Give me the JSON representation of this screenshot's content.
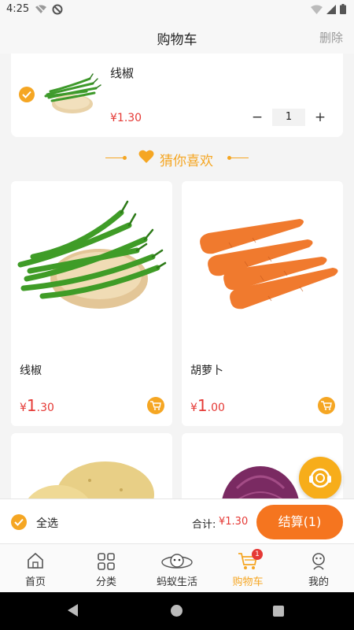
{
  "status_bar": {
    "time": "4:25",
    "icons": [
      "wifi-off-icon",
      "sync-disabled-icon",
      "wifi-icon",
      "signal-icon",
      "battery-icon"
    ]
  },
  "header": {
    "title": "购物车",
    "delete_label": "删除"
  },
  "cart_items": [
    {
      "name": "线椒",
      "price": "¥1.30",
      "quantity": "1",
      "minus": "−",
      "plus": "+",
      "checked": true
    }
  ],
  "recommend": {
    "title": "猜你喜欢",
    "products": [
      {
        "name": "线椒",
        "currency": "¥",
        "price_int": "1",
        "price_dec": ".30"
      },
      {
        "name": "胡萝卜",
        "currency": "¥",
        "price_int": "1",
        "price_dec": ".00"
      },
      {
        "name": "",
        "currency": "",
        "price_int": "",
        "price_dec": ""
      },
      {
        "name": "",
        "currency": "",
        "price_int": "",
        "price_dec": ""
      }
    ]
  },
  "checkout": {
    "select_all_label": "全选",
    "total_label": "合计:",
    "total_value": "¥1.30",
    "button_label": "结算(1)"
  },
  "tabbar": {
    "tabs": [
      {
        "label": "首页",
        "icon": "home-icon",
        "active": false
      },
      {
        "label": "分类",
        "icon": "category-icon",
        "active": false
      },
      {
        "label": "蚂蚁生活",
        "icon": "ant-life-icon",
        "active": false
      },
      {
        "label": "购物车",
        "icon": "cart-icon",
        "active": true,
        "badge": "1"
      },
      {
        "label": "我的",
        "icon": "profile-icon",
        "active": false
      }
    ]
  },
  "colors": {
    "accent": "#f5a623",
    "price_red": "#e53935",
    "checkout_orange": "#f5751f"
  }
}
